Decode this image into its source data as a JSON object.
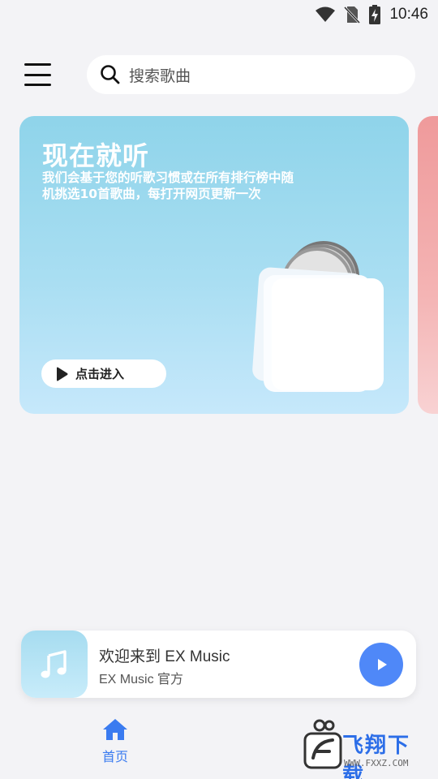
{
  "status_bar": {
    "time": "10:46"
  },
  "header": {
    "search_placeholder": "搜索歌曲"
  },
  "hero": {
    "title": "现在就听",
    "description": "我们会基于您的听歌习惯或在所有排行榜中随机挑选10首歌曲，每打开网页更新一次",
    "button_label": "点击进入"
  },
  "player": {
    "title": "欢迎来到 EX Music",
    "subtitle": "EX Music 官方"
  },
  "nav": {
    "home_label": "首页"
  },
  "watermark": {
    "text": "飞翔下载",
    "url": "WWW.FXXZ.COM"
  },
  "colors": {
    "accent": "#4f88f8",
    "hero_bg": "#a9def2",
    "peek_bg": "#f4b4b4"
  }
}
